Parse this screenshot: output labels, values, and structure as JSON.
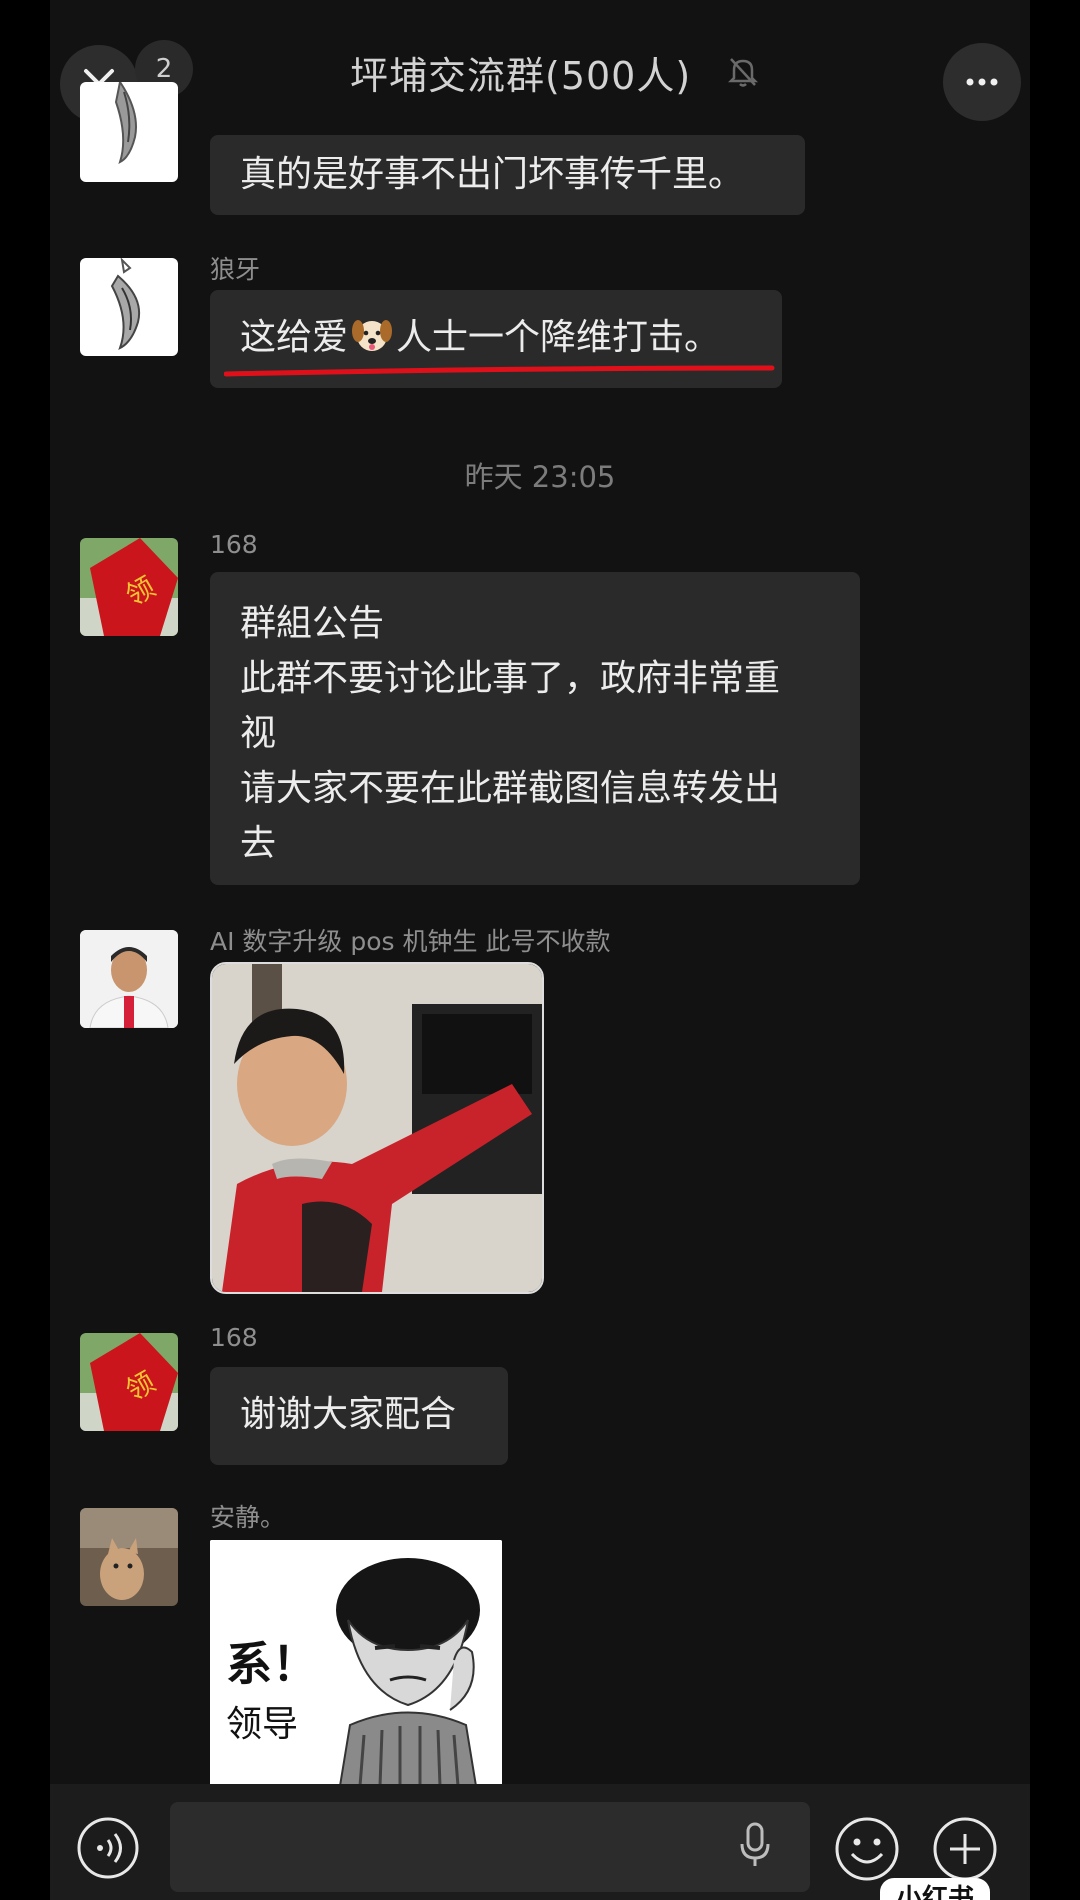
{
  "header": {
    "unread_count": "2",
    "title": "坪埔交流群(500人)"
  },
  "messages": [
    {
      "text": "真的是好事不出门坏事传千里。"
    },
    {
      "sender": "狼牙",
      "text_before": "这给爱",
      "emoji": "dog-face-emoji",
      "text_after": "人士一个降维打击。"
    },
    {
      "sender": "168",
      "lines": [
        "群組公告",
        "此群不要讨论此事了，政府非常重",
        "视",
        "请大家不要在此群截图信息转发出",
        "去"
      ]
    },
    {
      "sender": "AI 数字升级 pos 机钟生 此号不收款"
    },
    {
      "sender": "168",
      "text": "谢谢大家配合"
    },
    {
      "sender": "安静。",
      "sticker_text_1": "系！",
      "sticker_text_2": "领导"
    }
  ],
  "timestamp": "昨天 23:05",
  "watermark": "小红书",
  "colors": {
    "background": "#121212",
    "bubble": "#2a2a2a",
    "underline": "#e0101a"
  }
}
